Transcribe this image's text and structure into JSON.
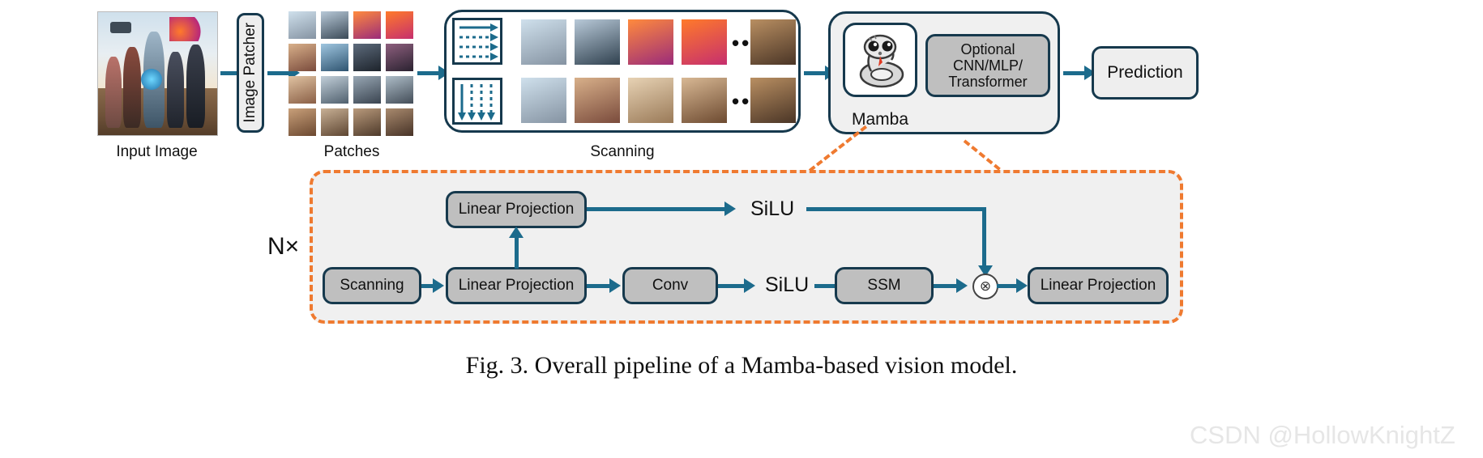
{
  "figure": {
    "caption": "Fig. 3.  Overall pipeline of a Mamba-based vision model.",
    "watermark": "CSDN @HollowKnightZ"
  },
  "colors": {
    "arrow": "#1c6b8c",
    "node_border": "#16394d",
    "node_fill": "#bfbfbf",
    "node_fill_light": "#eeeeee",
    "panel_fill": "#f0f0f0",
    "dashed_accent": "#ef7a30",
    "watermark": "#e6e6e6"
  },
  "pipeline": {
    "input_image": {
      "label": "Input Image"
    },
    "image_patcher": {
      "label": "Image Patcher"
    },
    "patches": {
      "label": "Patches",
      "rows": 4,
      "cols": 4
    },
    "scanning": {
      "label": "Scanning",
      "rows": [
        {
          "direction_icon": "horizontal-raster-scan-icon",
          "ellipsis": "•••"
        },
        {
          "direction_icon": "vertical-raster-scan-icon",
          "ellipsis": "•••"
        }
      ]
    },
    "backbone": {
      "mamba": {
        "label": "Mamba",
        "icon": "snake-icon"
      },
      "optional_block": {
        "label": "Optional\nCNN/MLP/\nTransformer",
        "line1": "Optional",
        "line2": "CNN/MLP/",
        "line3": "Transformer"
      }
    },
    "prediction": {
      "label": "Prediction"
    }
  },
  "mamba_block": {
    "repeat_label": "N×",
    "top_row": [
      {
        "id": "linear-projection-top",
        "label": "Linear Projection",
        "kind": "box"
      },
      {
        "id": "silu-top",
        "label": "SiLU",
        "kind": "text"
      }
    ],
    "bottom_row": [
      {
        "id": "scanning",
        "label": "Scanning",
        "kind": "box"
      },
      {
        "id": "linear-projection-in",
        "label": "Linear Projection",
        "kind": "box"
      },
      {
        "id": "conv",
        "label": "Conv",
        "kind": "box"
      },
      {
        "id": "silu-bottom",
        "label": "SiLU",
        "kind": "text"
      },
      {
        "id": "ssm",
        "label": "SSM",
        "kind": "box"
      },
      {
        "id": "multiply",
        "label": "⊗",
        "kind": "op"
      },
      {
        "id": "linear-projection-out",
        "label": "Linear Projection",
        "kind": "box"
      }
    ]
  }
}
